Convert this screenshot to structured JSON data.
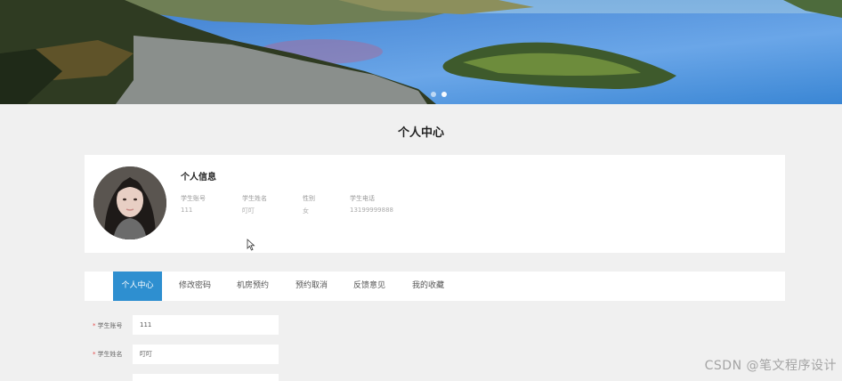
{
  "page": {
    "title": "个人中心"
  },
  "banner": {
    "slide_count": 2,
    "active_slide": 2
  },
  "profile": {
    "heading": "个人信息",
    "fields": [
      {
        "label": "学生账号",
        "value": "111"
      },
      {
        "label": "学生姓名",
        "value": "叮叮"
      },
      {
        "label": "性别",
        "value": "女"
      },
      {
        "label": "学生电话",
        "value": "13199999888"
      }
    ]
  },
  "tabs": [
    {
      "label": "个人中心",
      "active": true
    },
    {
      "label": "修改密码",
      "active": false
    },
    {
      "label": "机房预约",
      "active": false
    },
    {
      "label": "预约取消",
      "active": false
    },
    {
      "label": "反馈意见",
      "active": false
    },
    {
      "label": "我的收藏",
      "active": false
    }
  ],
  "form": {
    "fields": [
      {
        "required_mark": "*",
        "label": "学生账号",
        "value": "111"
      },
      {
        "required_mark": "*",
        "label": "学生姓名",
        "value": "叮叮"
      }
    ]
  },
  "watermark": "CSDN @笔文程序设计",
  "colors": {
    "accent": "#2e8fd0",
    "required": "#e54b4b",
    "background": "#f0f0f0"
  }
}
